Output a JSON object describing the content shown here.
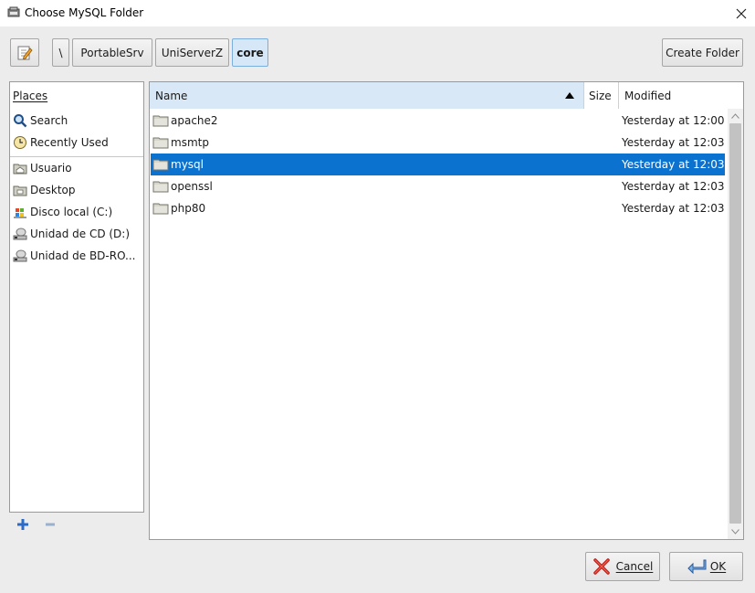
{
  "window": {
    "title": "Choose MySQL Folder"
  },
  "toolbar": {
    "breadcrumbs": [
      {
        "label": "\\"
      },
      {
        "label": "PortableSrv"
      },
      {
        "label": "UniServerZ"
      },
      {
        "label": "core",
        "active": true
      }
    ],
    "create_folder_label": "Create Folder"
  },
  "places": {
    "header": "Places",
    "items": [
      {
        "label": "Search",
        "icon": "magnifier-icon"
      },
      {
        "label": "Recently Used",
        "icon": "clock-icon"
      },
      {
        "label": "Usuario",
        "icon": "home-folder-icon"
      },
      {
        "label": "Desktop",
        "icon": "desktop-folder-icon"
      },
      {
        "label": "Disco local (C:)",
        "icon": "drive-icon"
      },
      {
        "label": "Unidad de CD (D:)",
        "icon": "cd-drive-icon"
      },
      {
        "label": "Unidad de BD-RO...",
        "icon": "bd-drive-icon"
      }
    ]
  },
  "files": {
    "columns": {
      "name": "Name",
      "size": "Size",
      "modified": "Modified"
    },
    "rows": [
      {
        "name": "apache2",
        "size": "",
        "modified": "Yesterday at 12:00",
        "selected": false
      },
      {
        "name": "msmtp",
        "size": "",
        "modified": "Yesterday at 12:03",
        "selected": false
      },
      {
        "name": "mysql",
        "size": "",
        "modified": "Yesterday at 12:03",
        "selected": true
      },
      {
        "name": "openssl",
        "size": "",
        "modified": "Yesterday at 12:03",
        "selected": false
      },
      {
        "name": "php80",
        "size": "",
        "modified": "Yesterday at 12:03",
        "selected": false
      }
    ]
  },
  "buttons": {
    "cancel_label": "Cancel",
    "ok_label": "OK"
  },
  "colors": {
    "selection": "#0b72d0",
    "header_highlight": "#d8e8f6",
    "dialog_bg": "#ececec"
  }
}
